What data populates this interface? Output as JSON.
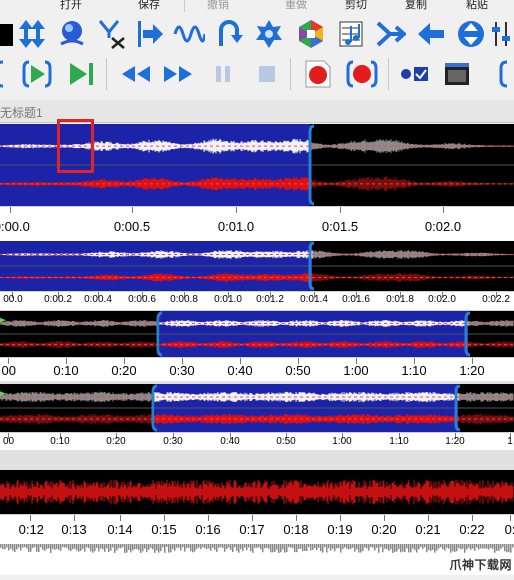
{
  "toolbar": {
    "labels": {
      "open": "打开",
      "save": "保存",
      "undo": "撤销",
      "redo": "重做",
      "cut": "剪切",
      "copy": "复制",
      "paste": "粘贴"
    }
  },
  "document": {
    "tab_title": "无标题1"
  },
  "rulers": {
    "r1": [
      "0:00.0",
      "0:00.5",
      "0:01.0",
      "0:01.5",
      "0:02.0"
    ],
    "r2": [
      "00.0",
      "0:00.2",
      "0:00.4",
      "0:00.6",
      "0:00.8",
      "0:01.0",
      "0:01.2",
      "0:01.4",
      "0:01.6",
      "0:01.8",
      "0:02.0",
      "0:02.2"
    ],
    "r3": [
      "00",
      "0:10",
      "0:20",
      "0:30",
      "0:40",
      "0:50",
      "1:00",
      "1:10",
      "1:20"
    ],
    "r4": [
      "00",
      "0:10",
      "0:20",
      "0:30",
      "0:40",
      "0:50",
      "1:00",
      "1:10",
      "1:20",
      "1"
    ],
    "r5": [
      "0:12",
      "0:13",
      "0:14",
      "0:15",
      "0:16",
      "0:17",
      "0:18",
      "0:19",
      "0:20",
      "0:21",
      "0:22",
      "0:"
    ]
  },
  "selection": {
    "panel1": [
      0.0,
      1.4
    ],
    "panel3": [
      0.27,
      1.22
    ],
    "panel4": [
      0.27,
      1.22
    ]
  },
  "colors": {
    "selection_bg": "#1b23a8",
    "waveform_left": "#f2f2f2",
    "waveform_right": "#e01010",
    "waveform_dim_left": "#8a8a8a",
    "waveform_dim_right": "#7a0d0d",
    "track_bg": "#000000",
    "handle": "#2a7fd4"
  },
  "watermark": "爪神下载网"
}
